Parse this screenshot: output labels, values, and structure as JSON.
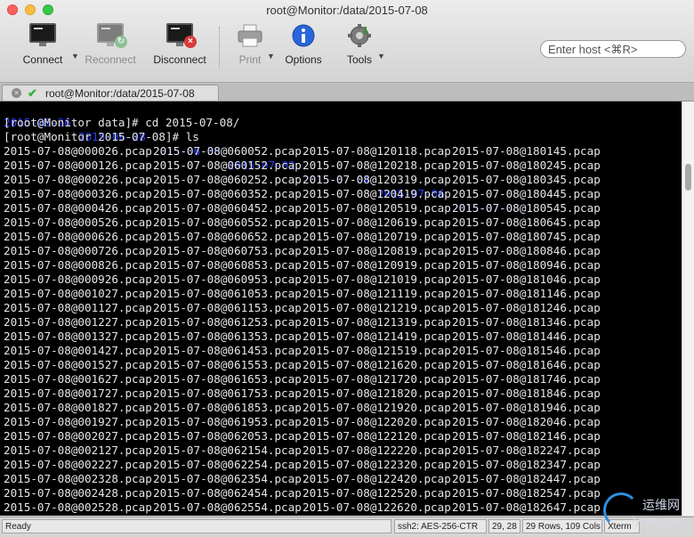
{
  "window": {
    "title": "root@Monitor:/data/2015-07-08"
  },
  "toolbar": {
    "connect": "Connect",
    "reconnect": "Reconnect",
    "disconnect": "Disconnect",
    "print": "Print",
    "options": "Options",
    "tools": "Tools",
    "search_placeholder": "Enter host <⌘R>"
  },
  "tab": {
    "label": "root@Monitor:/data/2015-07-08"
  },
  "terminal": {
    "top_dates": [
      "2015-06-26",
      "2015-06-28",
      "2015-06-30",
      "2015-07-02",
      "2015-07-04",
      "2015-07-06",
      "2015-07-08"
    ],
    "cmd1": "[root@Monitor data]# cd 2015-07-08/",
    "cmd2": "[root@Monitor 2015-07-08]# ls",
    "columns": [
      [
        "2015-07-08@000026.pcap",
        "2015-07-08@000126.pcap",
        "2015-07-08@000226.pcap",
        "2015-07-08@000326.pcap",
        "2015-07-08@000426.pcap",
        "2015-07-08@000526.pcap",
        "2015-07-08@000626.pcap",
        "2015-07-08@000726.pcap",
        "2015-07-08@000826.pcap",
        "2015-07-08@000926.pcap",
        "2015-07-08@001027.pcap",
        "2015-07-08@001127.pcap",
        "2015-07-08@001227.pcap",
        "2015-07-08@001327.pcap",
        "2015-07-08@001427.pcap",
        "2015-07-08@001527.pcap",
        "2015-07-08@001627.pcap",
        "2015-07-08@001727.pcap",
        "2015-07-08@001827.pcap",
        "2015-07-08@001927.pcap",
        "2015-07-08@002027.pcap",
        "2015-07-08@002127.pcap",
        "2015-07-08@002227.pcap",
        "2015-07-08@002328.pcap",
        "2015-07-08@002428.pcap",
        "2015-07-08@002528.pcap"
      ],
      [
        "2015-07-08@060052.pcap",
        "2015-07-08@060152.pcap",
        "2015-07-08@060252.pcap",
        "2015-07-08@060352.pcap",
        "2015-07-08@060452.pcap",
        "2015-07-08@060552.pcap",
        "2015-07-08@060652.pcap",
        "2015-07-08@060753.pcap",
        "2015-07-08@060853.pcap",
        "2015-07-08@060953.pcap",
        "2015-07-08@061053.pcap",
        "2015-07-08@061153.pcap",
        "2015-07-08@061253.pcap",
        "2015-07-08@061353.pcap",
        "2015-07-08@061453.pcap",
        "2015-07-08@061553.pcap",
        "2015-07-08@061653.pcap",
        "2015-07-08@061753.pcap",
        "2015-07-08@061853.pcap",
        "2015-07-08@061953.pcap",
        "2015-07-08@062053.pcap",
        "2015-07-08@062154.pcap",
        "2015-07-08@062254.pcap",
        "2015-07-08@062354.pcap",
        "2015-07-08@062454.pcap",
        "2015-07-08@062554.pcap"
      ],
      [
        "2015-07-08@120118.pcap",
        "2015-07-08@120218.pcap",
        "2015-07-08@120319.pcap",
        "2015-07-08@120419.pcap",
        "2015-07-08@120519.pcap",
        "2015-07-08@120619.pcap",
        "2015-07-08@120719.pcap",
        "2015-07-08@120819.pcap",
        "2015-07-08@120919.pcap",
        "2015-07-08@121019.pcap",
        "2015-07-08@121119.pcap",
        "2015-07-08@121219.pcap",
        "2015-07-08@121319.pcap",
        "2015-07-08@121419.pcap",
        "2015-07-08@121519.pcap",
        "2015-07-08@121620.pcap",
        "2015-07-08@121720.pcap",
        "2015-07-08@121820.pcap",
        "2015-07-08@121920.pcap",
        "2015-07-08@122020.pcap",
        "2015-07-08@122120.pcap",
        "2015-07-08@122220.pcap",
        "2015-07-08@122320.pcap",
        "2015-07-08@122420.pcap",
        "2015-07-08@122520.pcap",
        "2015-07-08@122620.pcap"
      ],
      [
        "2015-07-08@180145.pcap",
        "2015-07-08@180245.pcap",
        "2015-07-08@180345.pcap",
        "2015-07-08@180445.pcap",
        "2015-07-08@180545.pcap",
        "2015-07-08@180645.pcap",
        "2015-07-08@180745.pcap",
        "2015-07-08@180846.pcap",
        "2015-07-08@180946.pcap",
        "2015-07-08@181046.pcap",
        "2015-07-08@181146.pcap",
        "2015-07-08@181246.pcap",
        "2015-07-08@181346.pcap",
        "2015-07-08@181446.pcap",
        "2015-07-08@181546.pcap",
        "2015-07-08@181646.pcap",
        "2015-07-08@181746.pcap",
        "2015-07-08@181846.pcap",
        "2015-07-08@181946.pcap",
        "2015-07-08@182046.pcap",
        "2015-07-08@182146.pcap",
        "2015-07-08@182247.pcap",
        "2015-07-08@182347.pcap",
        "2015-07-08@182447.pcap",
        "2015-07-08@182547.pcap",
        "2015-07-08@182647.pcap"
      ]
    ]
  },
  "statusbar": {
    "ready": "Ready",
    "cipher": "ssh2: AES-256-CTR",
    "cursor": "29, 28",
    "size": "29 Rows, 109 Cols",
    "term": "Xterm"
  },
  "watermark": {
    "line1": "运维网",
    "line2": "iyunv.com"
  },
  "colors": {
    "terminal_bg": "#000000",
    "terminal_fg": "#e6e6e6",
    "date_blue": "#2b3fff",
    "accent": "#2e8fe0"
  }
}
